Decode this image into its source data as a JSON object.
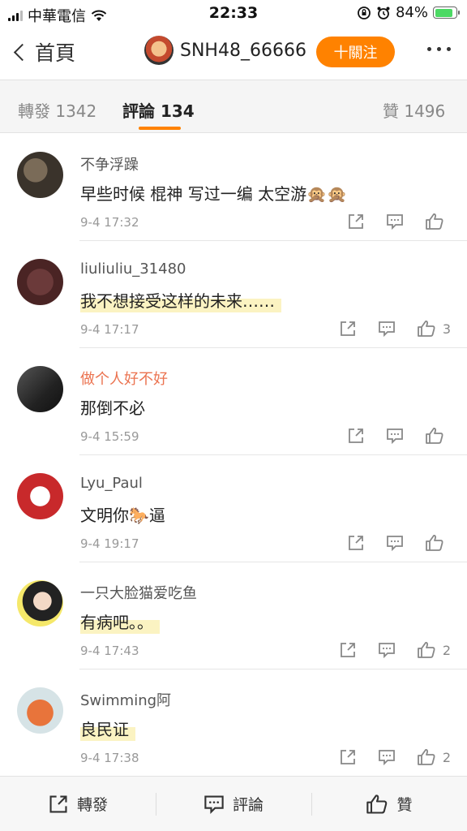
{
  "status_bar": {
    "carrier": "中華電信",
    "time": "22:33",
    "battery": "84%",
    "battery_level": 0.84
  },
  "nav": {
    "back_label": "首頁",
    "username": "SNH48_66666",
    "follow_label": "十關注"
  },
  "tabs": {
    "repost": "轉發 1342",
    "comment": "評論 134",
    "like": "贊 1496"
  },
  "comments": [
    {
      "name": "不争浮躁",
      "text": "早些时候 棍神 写过一编 太空游🙊🙊",
      "time": "9-4 17:32",
      "likes": ""
    },
    {
      "name": "liuliuliu_31480",
      "text": "我不想接受这样的未来……",
      "time": "9-4 17:17",
      "likes": "3"
    },
    {
      "name": "做个人好不好",
      "text": "那倒不必",
      "time": "9-4 15:59",
      "likes": ""
    },
    {
      "name": "Lyu_Paul",
      "text": "文明你🐎逼",
      "time": "9-4 19:17",
      "likes": ""
    },
    {
      "name": "一只大脸猫爱吃鱼",
      "text": "有病吧。。",
      "time": "9-4 17:43",
      "likes": "2"
    },
    {
      "name": "Swimming阿",
      "text": "良民证",
      "time": "9-4 17:38",
      "likes": "2"
    }
  ],
  "bottom_bar": {
    "repost": "轉發",
    "comment": "評論",
    "like": "贊"
  },
  "colors": {
    "accent": "#ff8200",
    "highlight": "#fbf3c2",
    "name_orange": "#eb7350"
  }
}
